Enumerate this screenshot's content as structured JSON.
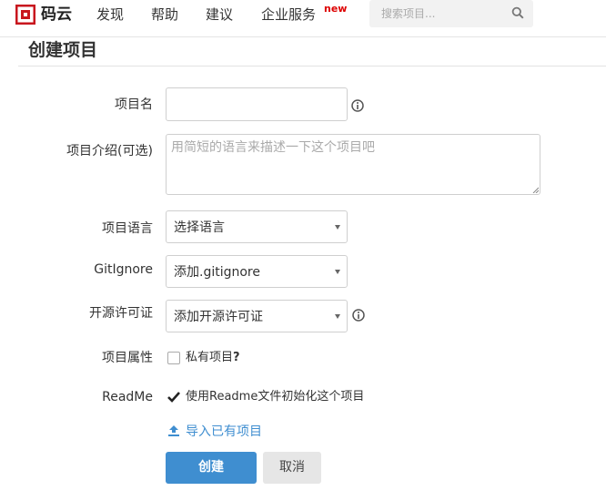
{
  "nav": {
    "brand": "码云",
    "items": [
      "发现",
      "帮助",
      "建议",
      "企业服务"
    ],
    "new_badge": "new",
    "search_placeholder": "搜索项目..."
  },
  "page": {
    "title": "创建项目"
  },
  "form": {
    "name_label": "项目名",
    "name_value": "",
    "desc_label": "项目介绍(可选)",
    "desc_placeholder": "用简短的语言来描述一下这个项目吧",
    "language_label": "项目语言",
    "language_value": "选择语言",
    "gitignore_label": "GitIgnore",
    "gitignore_value": "添加.gitignore",
    "license_label": "开源许可证",
    "license_value": "添加开源许可证",
    "attr_label": "项目属性",
    "private_text": "私有项目",
    "private_help": "?",
    "private_checked": false,
    "readme_label": "ReadMe",
    "readme_text": "使用Readme文件初始化这个项目",
    "readme_checked": true,
    "import_link": "导入已有项目",
    "create_button": "创建",
    "cancel_button": "取消"
  },
  "colors": {
    "primary": "#3f8ed0",
    "brand_red": "#c8161e",
    "badge_red": "#dd0000"
  }
}
